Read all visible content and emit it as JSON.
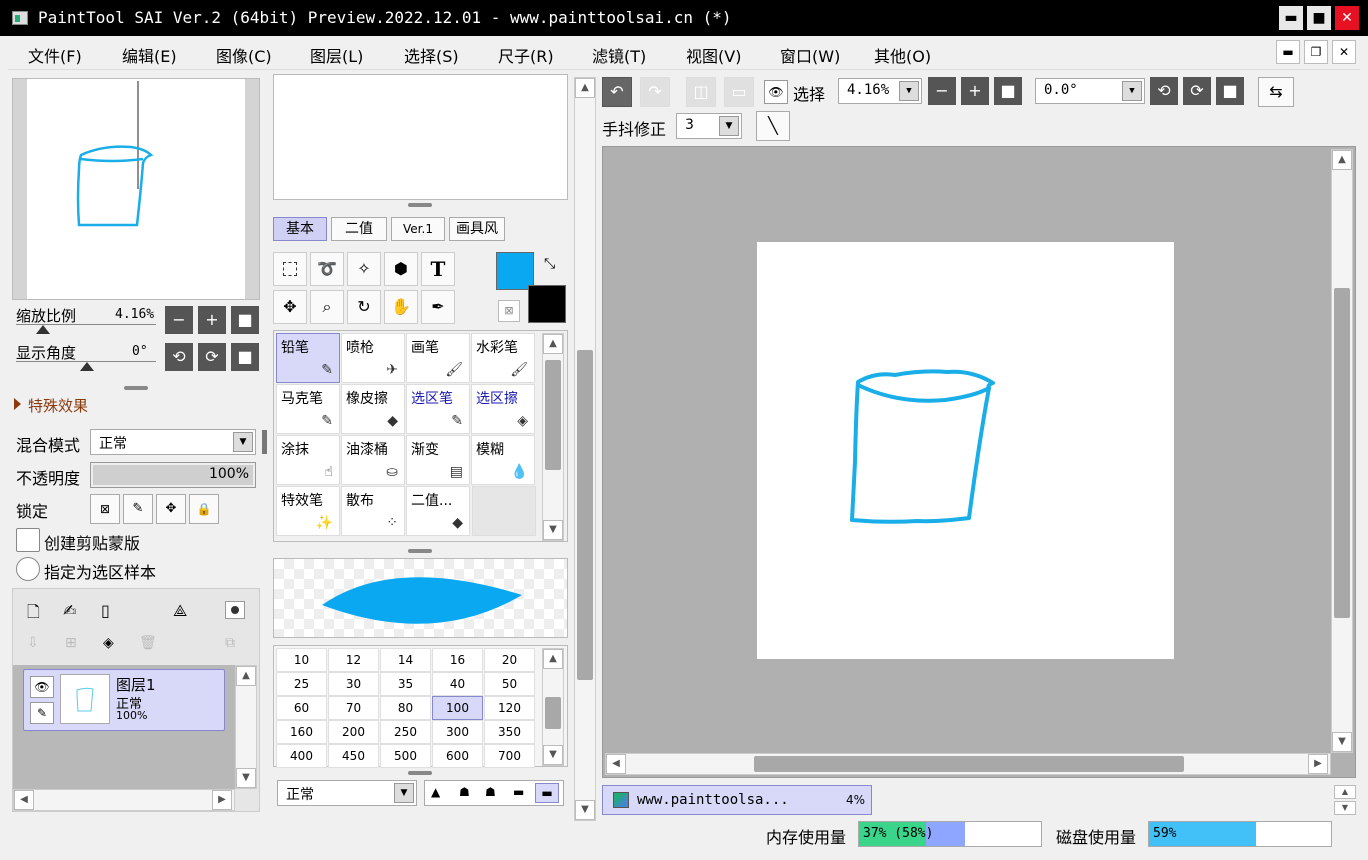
{
  "window": {
    "title": "PaintTool SAI Ver.2 (64bit) Preview.2022.12.01 - www.painttoolsai.cn (*)",
    "minimize": "▬",
    "maximize": "■",
    "close": "✕"
  },
  "menu": [
    "文件(F)",
    "编辑(E)",
    "图像(C)",
    "图层(L)",
    "选择(S)",
    "尺子(R)",
    "滤镜(T)",
    "视图(V)",
    "窗口(W)",
    "其他(O)"
  ],
  "navigator": {
    "zoom_label": "缩放比例",
    "zoom_value": "4.16%",
    "angle_label": "显示角度",
    "angle_value": "0°"
  },
  "effects": {
    "label": "特殊效果"
  },
  "layer_props": {
    "blend_label": "混合模式",
    "blend_value": "正常",
    "opacity_label": "不透明度",
    "opacity_value": "100%",
    "opacity_fraction": 1.0,
    "lock_label": "锁定",
    "clip_label": "创建剪贴蒙版",
    "sample_label": "指定为选区样本"
  },
  "layers": [
    {
      "name": "图层1",
      "mode": "正常",
      "opacity": "100%"
    }
  ],
  "tool_tabs": [
    "基本",
    "二值",
    "Ver.1",
    "画具风"
  ],
  "text_tool": "T",
  "tools": [
    {
      "label": "铅笔",
      "icon": "pencil-icon",
      "selected": true,
      "color": "#000000"
    },
    {
      "label": "喷枪",
      "icon": "airbrush-icon",
      "selected": false,
      "color": "#000000"
    },
    {
      "label": "画笔",
      "icon": "brush-icon",
      "selected": false,
      "color": "#000000"
    },
    {
      "label": "水彩笔",
      "icon": "watercolor-icon",
      "selected": false,
      "color": "#000000"
    },
    {
      "label": "马克笔",
      "icon": "marker-icon",
      "selected": false,
      "color": "#000000"
    },
    {
      "label": "橡皮擦",
      "icon": "eraser-icon",
      "selected": false,
      "color": "#000000"
    },
    {
      "label": "选区笔",
      "icon": "selpen-icon",
      "selected": false,
      "color": "#1a1ab0"
    },
    {
      "label": "选区擦",
      "icon": "selerase-icon",
      "selected": false,
      "color": "#1a1ab0"
    },
    {
      "label": "涂抹",
      "icon": "smudge-icon",
      "selected": false,
      "color": "#000000"
    },
    {
      "label": "油漆桶",
      "icon": "bucket-icon",
      "selected": false,
      "color": "#000000"
    },
    {
      "label": "渐变",
      "icon": "gradient-icon",
      "selected": false,
      "color": "#000000"
    },
    {
      "label": "模糊",
      "icon": "blur-icon",
      "selected": false,
      "color": "#000000"
    },
    {
      "label": "特效笔",
      "icon": "fx-pen-icon",
      "selected": false,
      "color": "#000000"
    },
    {
      "label": "散布",
      "icon": "scatter-icon",
      "selected": false,
      "color": "#000000"
    },
    {
      "label": "二值...",
      "icon": "binary-icon",
      "selected": false,
      "color": "#000000"
    }
  ],
  "colors": {
    "primary": "#0aa8f0",
    "secondary": "#000000",
    "stroke": "#1aaee8",
    "accent": "#d8d8f8"
  },
  "brush_sizes": [
    "10",
    "12",
    "14",
    "16",
    "20",
    "25",
    "30",
    "35",
    "40",
    "50",
    "60",
    "70",
    "80",
    "100",
    "120",
    "160",
    "200",
    "250",
    "300",
    "350",
    "400",
    "450",
    "500",
    "600",
    "700"
  ],
  "brush_selected": "100",
  "brush_mode": "正常",
  "canvas_toolbar": {
    "select_label": "选择",
    "zoom_value": "4.16%",
    "rotate_value": "0.0°",
    "stabilizer_label": "手抖修正",
    "stabilizer_value": "3"
  },
  "document_tab": {
    "name": "www.painttoolsa...",
    "zoom": "4%"
  },
  "status": {
    "mem_label": "内存使用量",
    "mem_value": "37% (58%)",
    "mem_fraction": 0.37,
    "mem_peak_fraction": 0.58,
    "disk_label": "磁盘使用量",
    "disk_value": "59%",
    "disk_fraction": 0.59
  }
}
